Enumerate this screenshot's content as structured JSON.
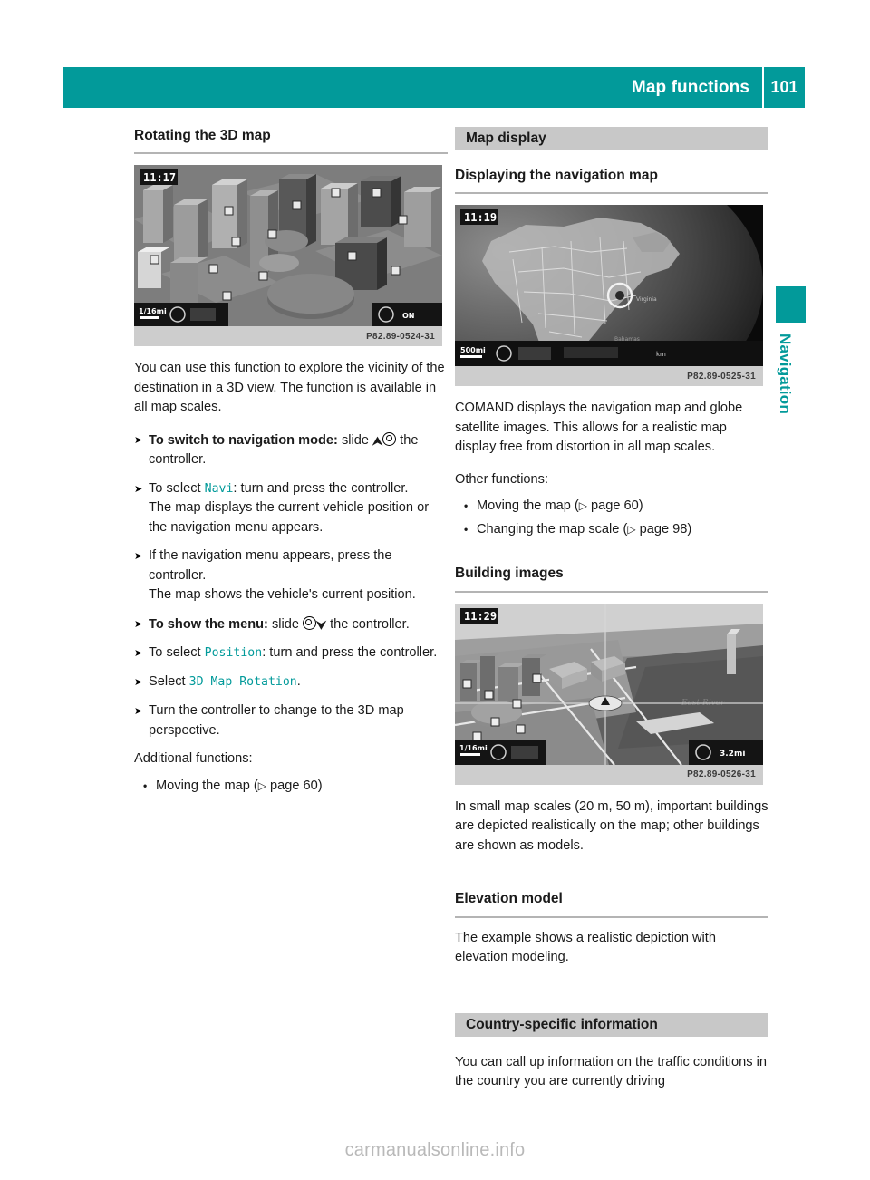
{
  "header": {
    "title": "Map functions",
    "page_number": "101"
  },
  "side_tab": {
    "label": "Navigation",
    "accent_color": "#029a9a"
  },
  "left_column": {
    "heading": "Rotating the 3D map",
    "figure": {
      "time_badge": "11:17",
      "scale_badge": "1/16mi",
      "right_badge": "ON",
      "caption": "P82.89-0524-31",
      "alt": "3D city map view with buildings"
    },
    "intro": "You can use this function to explore the vicinity of the destination in a 3D view. The function is available in all map scales.",
    "steps": [
      {
        "marker": "X",
        "bold_prefix": "To switch to navigation mode:",
        "text_before_glyph": " slide ",
        "glyph": "up-arrow-controller-ring",
        "text_after_glyph": "the controller."
      },
      {
        "marker": "X",
        "text_before_cmd": "To select ",
        "cmd": "Navi",
        "text_after_cmd": ": turn and press the controller.",
        "extra": "The map displays the current vehicle position or the navigation menu appears."
      },
      {
        "marker": "X",
        "text": "If the navigation menu appears, press the controller.",
        "extra": "The map shows the vehicle's current position."
      },
      {
        "marker": "X",
        "bold_prefix": "To show the menu:",
        "text_before_glyph": " slide ",
        "glyph": "controller-ring-down-arrow",
        "text_after_glyph": " the controller."
      },
      {
        "marker": "X",
        "text_before_cmd": "To select ",
        "cmd": "Position",
        "text_after_cmd": ": turn and press the controller."
      },
      {
        "marker": "X",
        "text_before_cmd": "Select ",
        "cmd": "3D Map Rotation",
        "text_after_cmd": "."
      },
      {
        "marker": "X",
        "text": "Turn the controller to change to the 3D map perspective."
      }
    ],
    "additional_label": "Additional functions:",
    "additional_items": [
      {
        "marker": "R",
        "text": "Moving the map (",
        "ref_arrow": "Y",
        "ref": " page 60)"
      }
    ]
  },
  "right_column": {
    "section_bar_1": "Map display",
    "heading_1": "Displaying the navigation map",
    "figure_1": {
      "time_badge": "11:19",
      "scale_badge": "500mi",
      "caption": "P82.89-0525-31",
      "alt": "Satellite globe view of North America"
    },
    "paragraph_1": "COMAND displays the navigation map and globe satellite images. This allows for a realistic map display free from distortion in all map scales.",
    "other_functions_label": "Other functions:",
    "other_functions": [
      {
        "marker": "R",
        "text": "Moving the map (",
        "ref_arrow": "Y",
        "ref": " page 60)"
      },
      {
        "marker": "R",
        "text": "Changing the map scale (",
        "ref_arrow": "Y",
        "ref": " page 98)"
      }
    ],
    "heading_2": "Building images",
    "figure_2": {
      "time_badge": "11:29",
      "scale_badge": "1/16mi",
      "right_badge": "3.2mi",
      "water_label": "East River",
      "caption": "P82.89-0526-31",
      "alt": "3D building images map with crosshair"
    },
    "paragraph_2": "In small map scales (20 m, 50 m), important buildings are depicted realistically on the map; other buildings are shown as models.",
    "heading_3": "Elevation model",
    "paragraph_3": "The example shows a realistic depiction with elevation modeling.",
    "section_bar_2": "Country-specific information",
    "paragraph_4": "You can call up information on the traffic conditions in the country you are currently driving"
  },
  "watermark": "carmanualsonline.info"
}
